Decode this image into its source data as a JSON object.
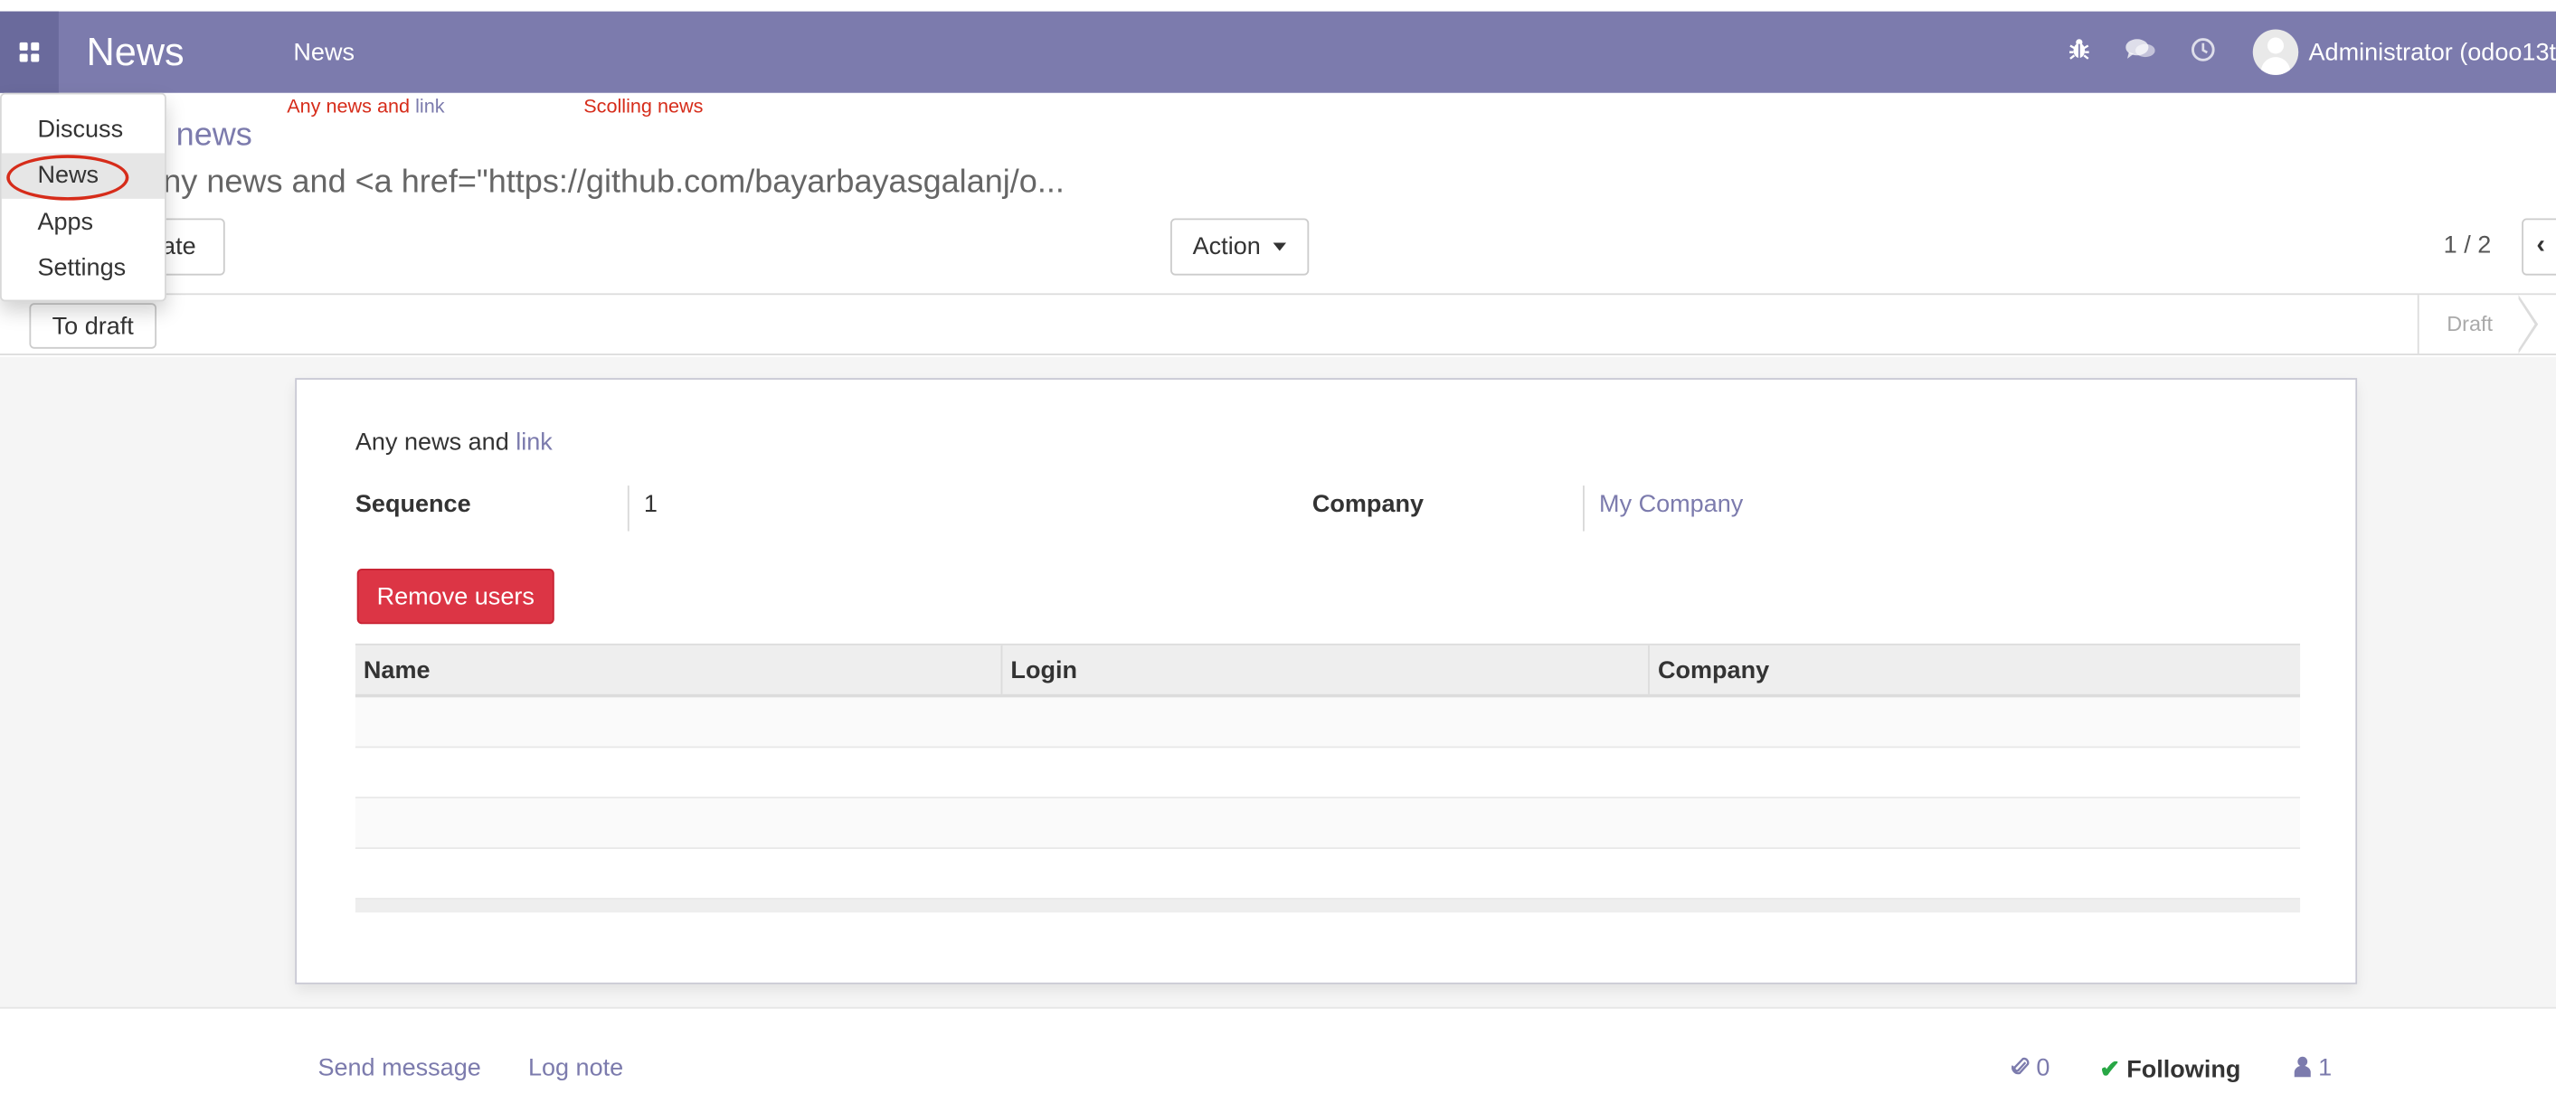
{
  "navbar": {
    "brand": "News",
    "menu_item": "News",
    "user": "Administrator (odoo13t"
  },
  "annotations": {
    "first_prefix": "Any news and ",
    "first_link": "link",
    "second": "Scolling news"
  },
  "app_menu": {
    "items": [
      "Discuss",
      "News",
      "Apps",
      "Settings"
    ],
    "active": "News"
  },
  "control_panel": {
    "breadcrumb": "news",
    "record_name": "ny news and <a href=\"https://github.com/bayarbayasgalanj/o...",
    "create_label": "eate",
    "action_label": "Action",
    "pager": "1 / 2",
    "pager_prev": "‹"
  },
  "statusbar": {
    "to_draft_label": "To draft",
    "stage": "Draft"
  },
  "form": {
    "description_prefix": "Any news and ",
    "description_link": "link",
    "sequence_label": "Sequence",
    "sequence_value": "1",
    "company_label": "Company",
    "company_value": "My Company",
    "remove_users_label": "Remove users",
    "table": {
      "columns": [
        "Name",
        "Login",
        "Company"
      ],
      "rows": []
    }
  },
  "chatter": {
    "send_message": "Send message",
    "log_note": "Log note",
    "attachments": "0",
    "following": "Following",
    "followers": "1"
  },
  "colors": {
    "brand": "#7c7bad",
    "danger": "#dc3545",
    "annotation": "#d62c1a",
    "success": "#28a745"
  }
}
